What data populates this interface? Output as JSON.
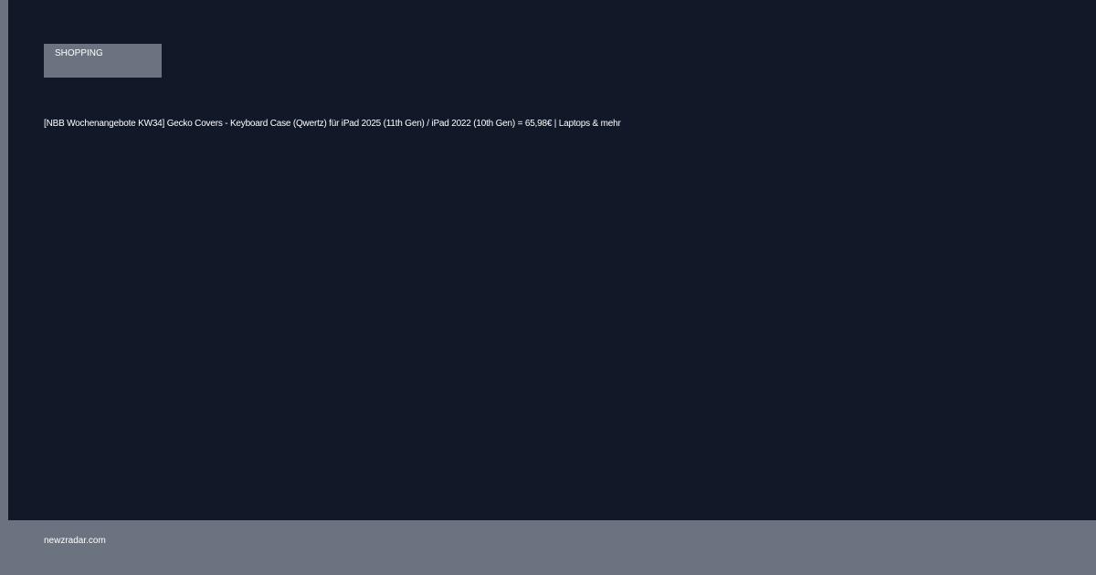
{
  "card": {
    "category": "SHOPPING",
    "headline": "[NBB Wochenangebote KW34] Gecko Covers - Keyboard Case (Qwertz) für iPad 2025 (11th Gen) / iPad 2022 (10th Gen) = 65,98€ | Laptops & mehr"
  },
  "footer": {
    "source": "newzradar.com"
  },
  "colors": {
    "card_background": "#111827",
    "page_background": "#6b7280",
    "badge_background": "#6b7280",
    "text": "#ffffff"
  }
}
